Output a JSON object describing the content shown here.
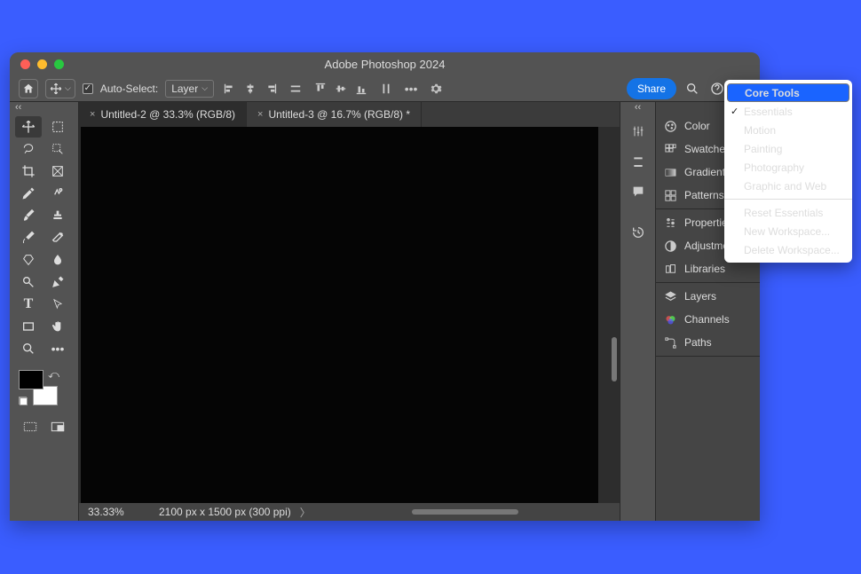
{
  "app": {
    "title": "Adobe Photoshop 2024"
  },
  "options": {
    "auto_select_label": "Auto-Select:",
    "layer_label": "Layer",
    "share_label": "Share"
  },
  "tabs": [
    {
      "label": "Untitled-2 @ 33.3% (RGB/8)",
      "active": true
    },
    {
      "label": "Untitled-3 @ 16.7% (RGB/8) *",
      "active": false
    }
  ],
  "status": {
    "zoom": "33.33%",
    "doc_info": "2100 px x 1500 px (300 ppi)"
  },
  "panels": {
    "group1": [
      "Color",
      "Swatches",
      "Gradients",
      "Patterns"
    ],
    "group2": [
      "Properties",
      "Adjustments",
      "Libraries"
    ],
    "group3": [
      "Layers",
      "Channels",
      "Paths"
    ]
  },
  "workspace_menu": {
    "items": [
      {
        "label": "Core Tools",
        "selected": true
      },
      {
        "label": "Essentials",
        "checked": true
      },
      {
        "label": "Motion"
      },
      {
        "label": "Painting"
      },
      {
        "label": "Photography"
      },
      {
        "label": "Graphic and Web"
      }
    ],
    "actions": [
      {
        "label": "Reset Essentials"
      },
      {
        "label": "New Workspace..."
      },
      {
        "label": "Delete Workspace..."
      }
    ]
  }
}
